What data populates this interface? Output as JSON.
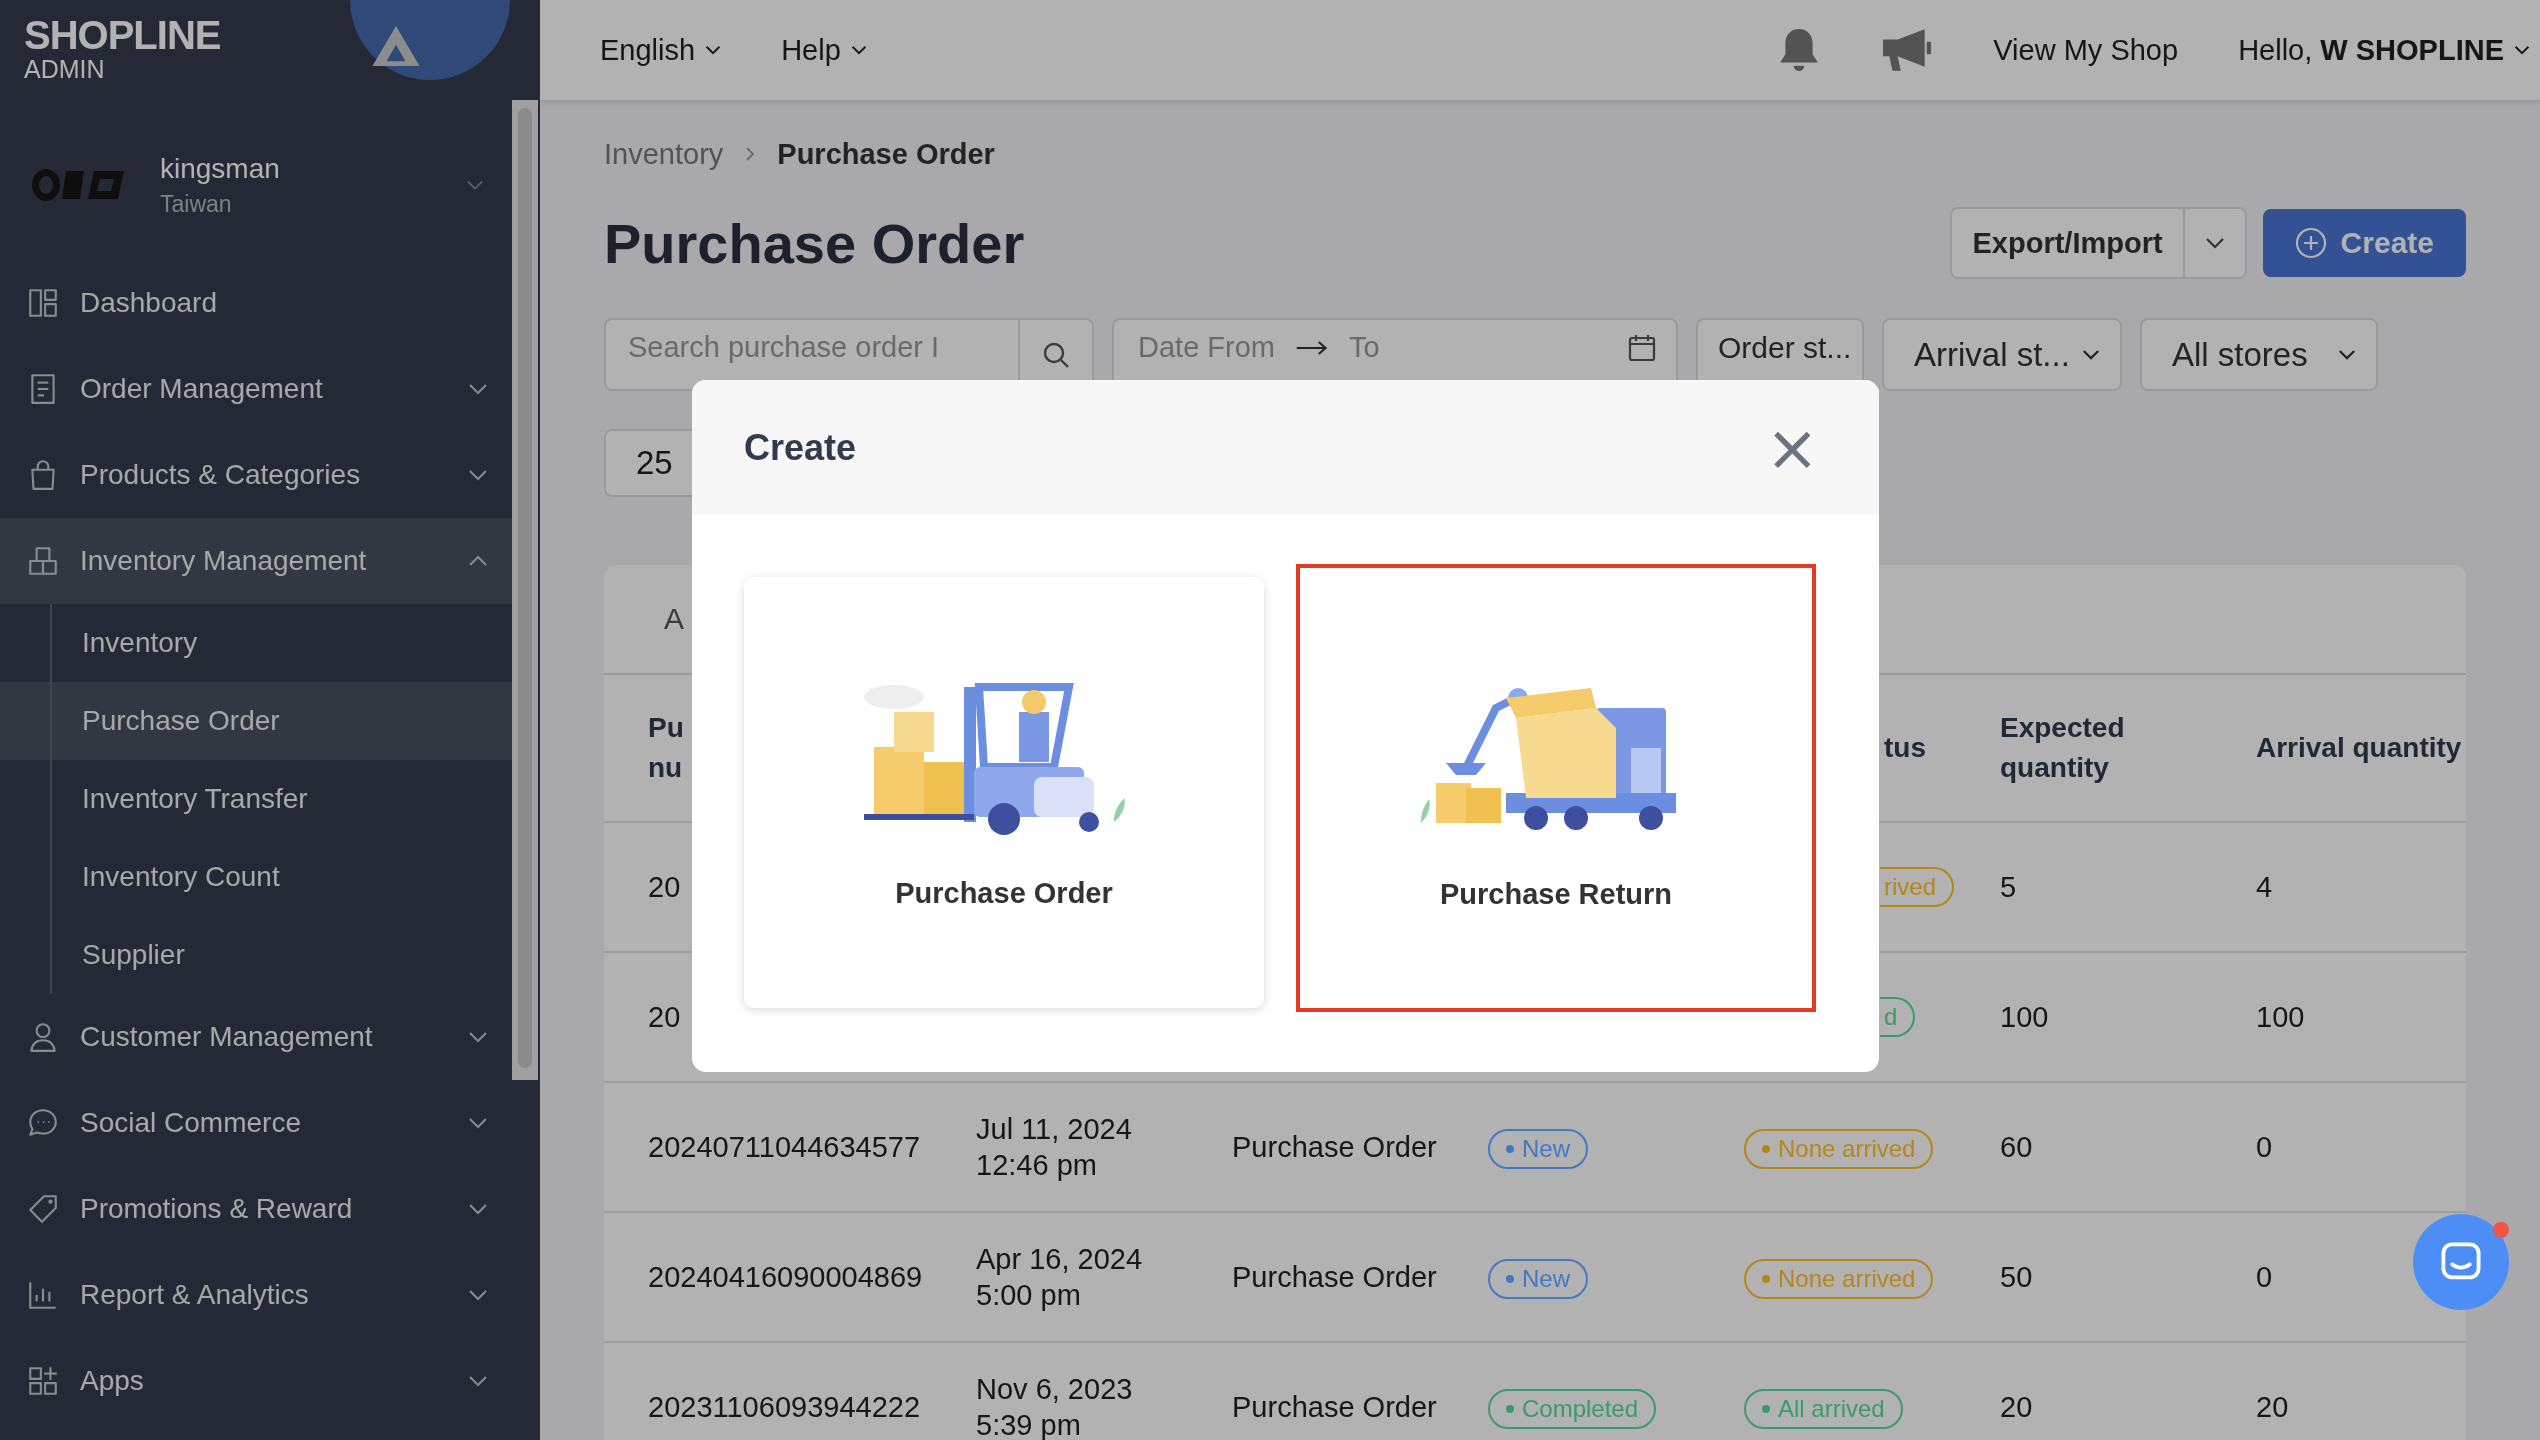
{
  "brand": {
    "name": "SHOPLINE",
    "subtitle": "ADMIN"
  },
  "store": {
    "name": "kingsman",
    "region": "Taiwan"
  },
  "nav": [
    {
      "label": "Dashboard",
      "kind": "dashboard",
      "selected": false
    },
    {
      "label": "Order Management",
      "kind": "order",
      "selected": false,
      "expanded": false
    },
    {
      "label": "Products & Categories",
      "kind": "bag",
      "selected": false,
      "expanded": false
    },
    {
      "label": "Inventory Management",
      "kind": "inventory",
      "selected": true,
      "expanded": true,
      "children": [
        {
          "label": "Inventory",
          "selected": false
        },
        {
          "label": "Purchase Order",
          "selected": true
        },
        {
          "label": "Inventory Transfer",
          "selected": false
        },
        {
          "label": "Inventory Count",
          "selected": false
        },
        {
          "label": "Supplier",
          "selected": false
        }
      ]
    },
    {
      "label": "Customer Management",
      "kind": "person",
      "selected": false,
      "expanded": false
    },
    {
      "label": "Social Commerce",
      "kind": "chat",
      "selected": false,
      "expanded": false
    },
    {
      "label": "Promotions & Reward",
      "kind": "tag",
      "selected": false,
      "expanded": false
    },
    {
      "label": "Report & Analytics",
      "kind": "report",
      "selected": false,
      "expanded": false
    },
    {
      "label": "Apps",
      "kind": "apps",
      "selected": false,
      "expanded": false
    }
  ],
  "topbar": {
    "language": "English",
    "help": "Help",
    "view_shop": "View My Shop",
    "greeting": "Hello, **W SHOPLINE**"
  },
  "breadcrumb": [
    "Inventory",
    "Purchase Order"
  ],
  "title": "Purchase Order",
  "actions": {
    "export_import": "Export/Import",
    "create": "Create"
  },
  "filters": {
    "search_placeholder": "Search purchase order I",
    "date_from": "Date From",
    "date_to": "To",
    "dropdowns": [
      "Order st...",
      "Arrival st...",
      "All stores"
    ],
    "page_size": "25"
  },
  "table": {
    "tab": "A",
    "columns": [
      {
        "lines": [
          "Pu",
          "nu"
        ]
      },
      null,
      null,
      null,
      {
        "lines": [
          "tus"
        ]
      },
      {
        "lines": [
          "Expected",
          "quantity"
        ]
      },
      {
        "lines": [
          "Arrival quantity"
        ]
      }
    ],
    "rows": [
      {
        "number": "20",
        "arrival_status": {
          "text": "rived",
          "color": "#b5861c"
        },
        "expected": "5",
        "arrived": "4"
      },
      {
        "number": "20",
        "arrival_status": {
          "text": "d",
          "color": "#3b9a6c"
        },
        "expected": "100",
        "arrived": "100"
      },
      {
        "number": "20240711044634577",
        "date": [
          "Jul 11, 2024",
          "12:46 pm"
        ],
        "type": "Purchase Order",
        "order_status": {
          "text": "New",
          "color": "#4677c4"
        },
        "arrival_status": {
          "text": "None arrived",
          "color": "#b5861c"
        },
        "expected": "60",
        "arrived": "0"
      },
      {
        "number": "20240416090004869",
        "date": [
          "Apr 16, 2024",
          "5:00 pm"
        ],
        "type": "Purchase Order",
        "order_status": {
          "text": "New",
          "color": "#4677c4"
        },
        "arrival_status": {
          "text": "None arrived",
          "color": "#b5861c"
        },
        "expected": "50",
        "arrived": "0"
      },
      {
        "number": "20231106093944222",
        "date": [
          "Nov 6, 2023",
          "5:39 pm"
        ],
        "type": "Purchase Order",
        "order_status": {
          "text": "Completed",
          "color": "#3b9a6c"
        },
        "arrival_status": {
          "text": "All arrived",
          "color": "#3b9a6c"
        },
        "expected": "20",
        "arrived": "20"
      }
    ]
  },
  "modal": {
    "title": "Create",
    "close": "×",
    "options": [
      {
        "label": "Purchase Order",
        "kind": "forklift",
        "selected": false
      },
      {
        "label": "Purchase Return",
        "kind": "truck",
        "selected": true
      }
    ]
  }
}
